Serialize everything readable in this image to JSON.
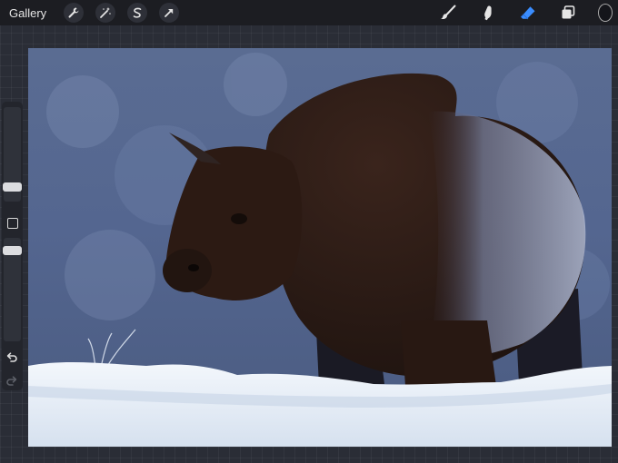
{
  "topbar": {
    "gallery_label": "Gallery",
    "left_tools": [
      "wrench-icon",
      "magic-wand-icon",
      "selection-icon",
      "transform-arrow-icon"
    ],
    "right_tools": [
      "brush-icon",
      "smudge-icon",
      "eraser-icon",
      "layers-icon",
      "color-well"
    ]
  },
  "colors": {
    "topbar": "#1c1d22",
    "workspace": "#2a2d36",
    "active_tool": "#3a8dff",
    "canvas_sky": "#546690",
    "snow": "#e6edf7",
    "bison_dark": "#2a1a14"
  },
  "sidebar": {
    "controls": [
      "brush-size-slider",
      "modify-button",
      "opacity-slider",
      "undo-button",
      "redo-button"
    ]
  },
  "canvas": {
    "subject": "bison-in-snow"
  }
}
